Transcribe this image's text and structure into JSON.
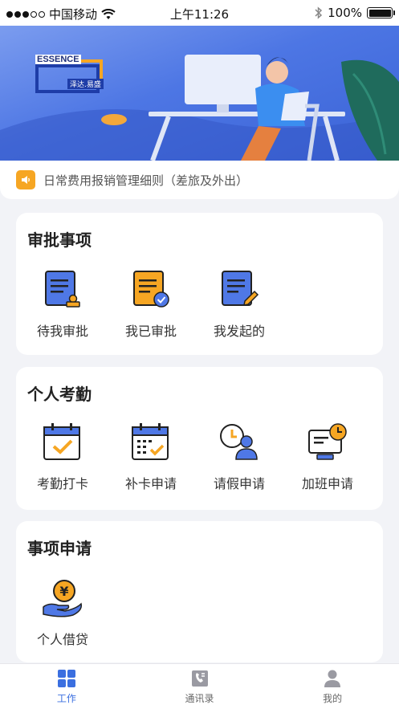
{
  "status_bar": {
    "carrier": "中国移动",
    "time": "上午11:26",
    "battery": "100%"
  },
  "banner": {
    "logo_text": "ESSENCE",
    "logo_subtext": "泽达.易盛"
  },
  "notice": {
    "text": "日常费用报销管理细则（差旅及外出）"
  },
  "sections": [
    {
      "title": "审批事项",
      "items": [
        {
          "label": "待我审批",
          "icon": "pending-approval-icon"
        },
        {
          "label": "我已审批",
          "icon": "approved-icon"
        },
        {
          "label": "我发起的",
          "icon": "initiated-icon"
        }
      ]
    },
    {
      "title": "个人考勤",
      "items": [
        {
          "label": "考勤打卡",
          "icon": "attendance-clock-in-icon"
        },
        {
          "label": "补卡申请",
          "icon": "card-replacement-icon"
        },
        {
          "label": "请假申请",
          "icon": "leave-request-icon"
        },
        {
          "label": "加班申请",
          "icon": "overtime-request-icon"
        }
      ]
    },
    {
      "title": "事项申请",
      "items": [
        {
          "label": "个人借贷",
          "icon": "personal-loan-icon"
        }
      ]
    }
  ],
  "tabbar": {
    "tabs": [
      {
        "label": "工作",
        "icon": "grid-icon",
        "active": true
      },
      {
        "label": "通讯录",
        "icon": "contacts-icon",
        "active": false
      },
      {
        "label": "我的",
        "icon": "user-icon",
        "active": false
      }
    ]
  },
  "colors": {
    "accent": "#3b6fe0",
    "icon_blue": "#4f78e6",
    "icon_orange": "#f6a623"
  }
}
